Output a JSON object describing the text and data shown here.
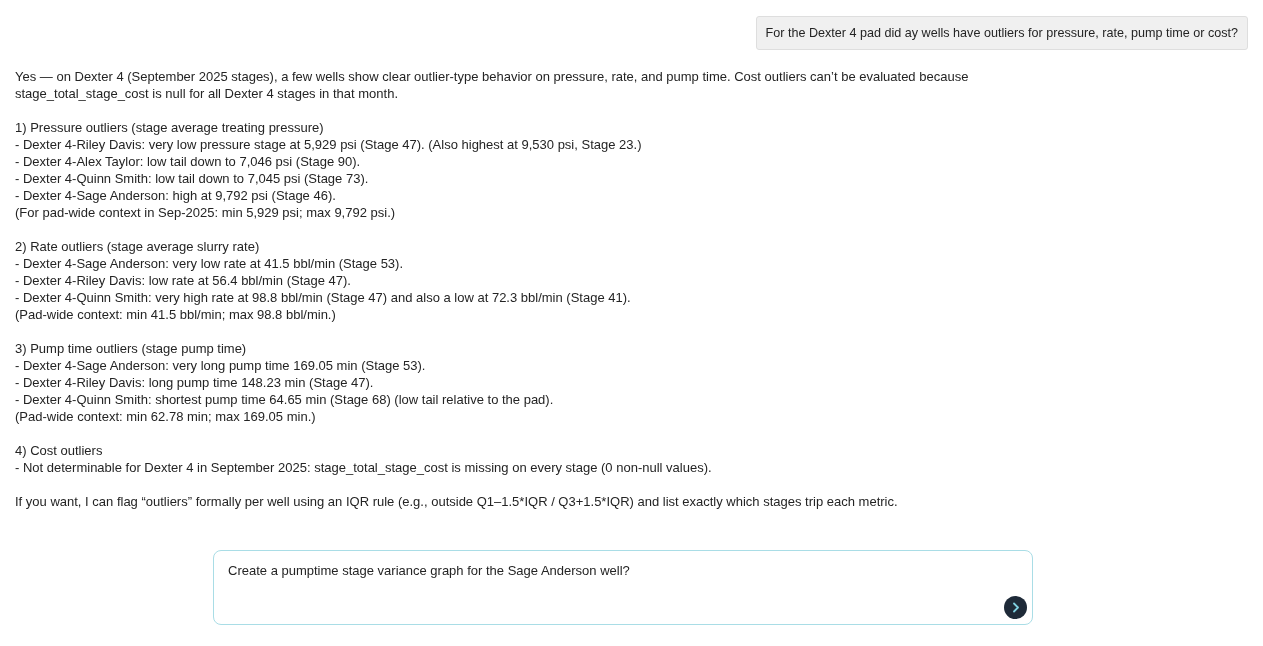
{
  "user_message": {
    "text": "For the Dexter 4 pad did ay wells have outliers for pressure, rate, pump time or cost?"
  },
  "response": {
    "paragraphs": [
      {
        "lines": [
          "Yes — on Dexter 4 (September 2025 stages), a few wells show clear outlier-type behavior on pressure, rate, and pump time. Cost outliers can’t be evaluated because stage_total_stage_cost is null for all Dexter 4 stages in that month."
        ]
      },
      {
        "lines": [
          "1) Pressure outliers (stage average treating pressure)",
          "- Dexter 4-Riley Davis: very low pressure stage at 5,929 psi (Stage 47). (Also highest at 9,530 psi, Stage 23.)",
          "- Dexter 4-Alex Taylor: low tail down to 7,046 psi (Stage 90).",
          "- Dexter 4-Quinn Smith: low tail down to 7,045 psi (Stage 73).",
          "- Dexter 4-Sage Anderson: high at 9,792 psi (Stage 46).",
          "(For pad-wide context in Sep-2025: min 5,929 psi; max 9,792 psi.)"
        ]
      },
      {
        "lines": [
          "2) Rate outliers (stage average slurry rate)",
          "- Dexter 4-Sage Anderson: very low rate at 41.5 bbl/min (Stage 53).",
          "- Dexter 4-Riley Davis: low rate at 56.4 bbl/min (Stage 47).",
          "- Dexter 4-Quinn Smith: very high rate at 98.8 bbl/min (Stage 47) and also a low at 72.3 bbl/min (Stage 41).",
          "(Pad-wide context: min 41.5 bbl/min; max 98.8 bbl/min.)"
        ]
      },
      {
        "lines": [
          "3) Pump time outliers (stage pump time)",
          "- Dexter 4-Sage Anderson: very long pump time 169.05 min (Stage 53).",
          "- Dexter 4-Riley Davis: long pump time 148.23 min (Stage 47).",
          "- Dexter 4-Quinn Smith: shortest pump time 64.65 min (Stage 68) (low tail relative to the pad).",
          "(Pad-wide context: min 62.78 min; max 169.05 min.)"
        ]
      },
      {
        "lines": [
          "4) Cost outliers",
          "- Not determinable for Dexter 4 in September 2025: stage_total_stage_cost is missing on every stage (0 non-null values)."
        ]
      },
      {
        "lines": [
          "If you want, I can flag “outliers” formally per well using an IQR rule (e.g., outside Q1–1.5*IQR / Q3+1.5*IQR) and list exactly which stages trip each metric."
        ]
      }
    ]
  },
  "composer": {
    "value": "Create a pumptime stage variance graph for the Sage Anderson well?"
  }
}
